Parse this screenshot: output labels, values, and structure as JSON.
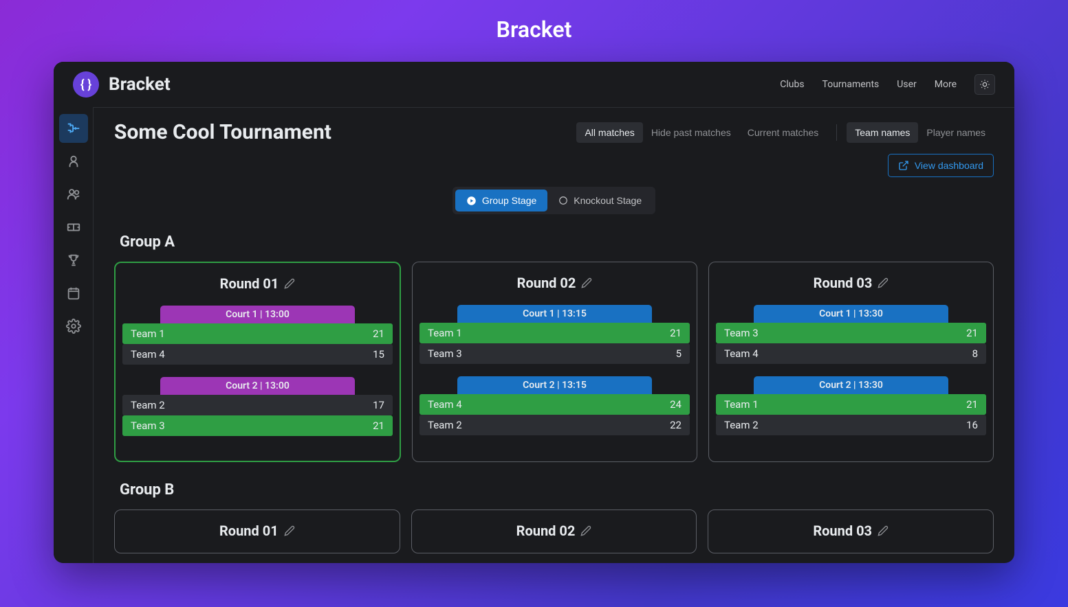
{
  "page_heading": "Bracket",
  "app": {
    "name": "Bracket"
  },
  "header_nav": {
    "clubs": "Clubs",
    "tournaments": "Tournaments",
    "user": "User",
    "more": "More"
  },
  "tournament": {
    "title": "Some Cool Tournament"
  },
  "filters": {
    "all": "All matches",
    "hide_past": "Hide past matches",
    "current": "Current matches",
    "team_names": "Team names",
    "player_names": "Player names"
  },
  "dashboard_btn": "View dashboard",
  "stages": {
    "group": "Group Stage",
    "knockout": "Knockout Stage"
  },
  "groups": [
    {
      "name": "Group A",
      "rounds": [
        {
          "title": "Round 01",
          "active": true,
          "matches": [
            {
              "head": "Court 1 | 13:00",
              "head_color": "purple",
              "rows": [
                {
                  "team": "Team 1",
                  "score": "21",
                  "win": true
                },
                {
                  "team": "Team 4",
                  "score": "15",
                  "win": false
                }
              ]
            },
            {
              "head": "Court 2 | 13:00",
              "head_color": "purple",
              "rows": [
                {
                  "team": "Team 2",
                  "score": "17",
                  "win": false
                },
                {
                  "team": "Team 3",
                  "score": "21",
                  "win": true
                }
              ]
            }
          ]
        },
        {
          "title": "Round 02",
          "active": false,
          "matches": [
            {
              "head": "Court 1 | 13:15",
              "head_color": "blue",
              "rows": [
                {
                  "team": "Team 1",
                  "score": "21",
                  "win": true
                },
                {
                  "team": "Team 3",
                  "score": "5",
                  "win": false
                }
              ]
            },
            {
              "head": "Court 2 | 13:15",
              "head_color": "blue",
              "rows": [
                {
                  "team": "Team 4",
                  "score": "24",
                  "win": true
                },
                {
                  "team": "Team 2",
                  "score": "22",
                  "win": false
                }
              ]
            }
          ]
        },
        {
          "title": "Round 03",
          "active": false,
          "matches": [
            {
              "head": "Court 1 | 13:30",
              "head_color": "blue",
              "rows": [
                {
                  "team": "Team 3",
                  "score": "21",
                  "win": true
                },
                {
                  "team": "Team 4",
                  "score": "8",
                  "win": false
                }
              ]
            },
            {
              "head": "Court 2 | 13:30",
              "head_color": "blue",
              "rows": [
                {
                  "team": "Team 1",
                  "score": "21",
                  "win": true
                },
                {
                  "team": "Team 2",
                  "score": "16",
                  "win": false
                }
              ]
            }
          ]
        }
      ]
    },
    {
      "name": "Group B",
      "rounds": [
        {
          "title": "Round 01",
          "active": false,
          "matches": []
        },
        {
          "title": "Round 02",
          "active": false,
          "matches": []
        },
        {
          "title": "Round 03",
          "active": false,
          "matches": []
        }
      ]
    }
  ]
}
